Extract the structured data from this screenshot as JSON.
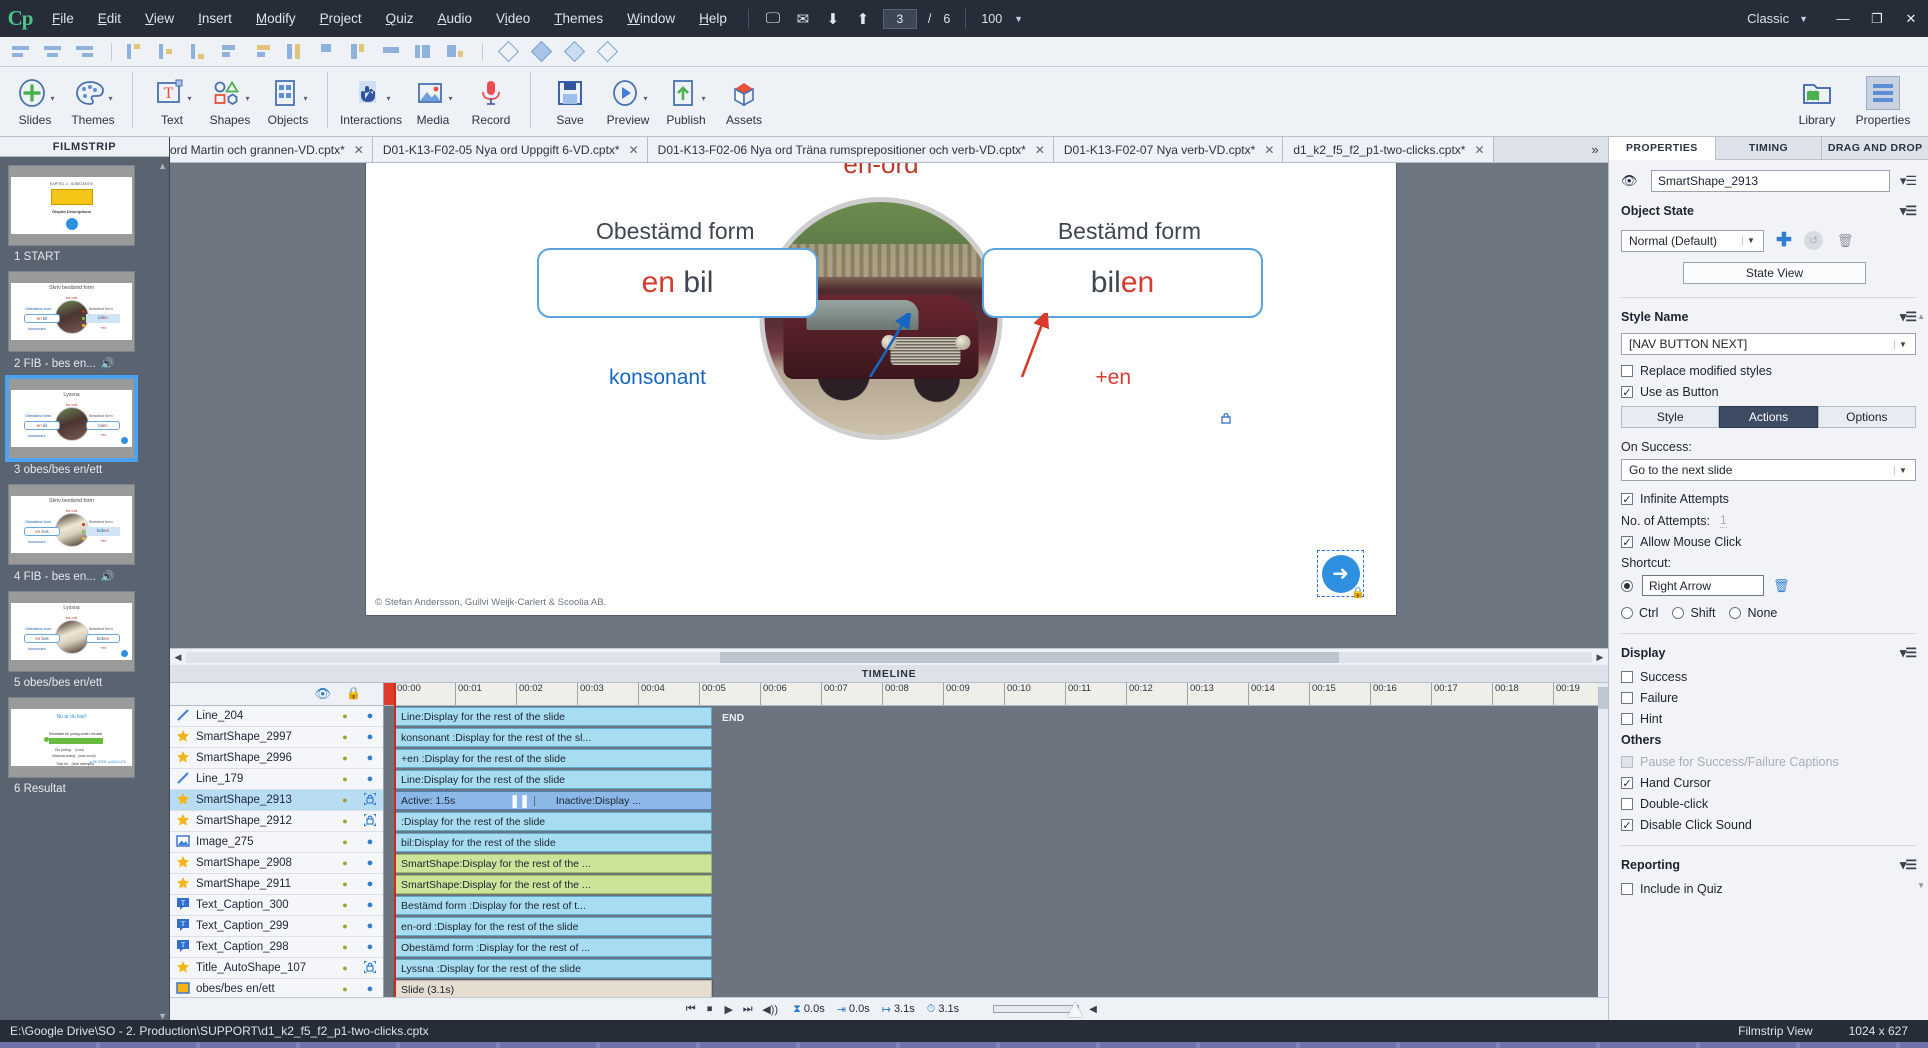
{
  "app": {
    "logo": "Cp",
    "layout_preset": "Classic"
  },
  "menu": {
    "items": [
      "File",
      "Edit",
      "View",
      "Insert",
      "Modify",
      "Project",
      "Quiz",
      "Audio",
      "Video",
      "Themes",
      "Window",
      "Help"
    ],
    "slide_current": "3",
    "slide_sep": "/",
    "slide_total": "6",
    "zoom_value": "100"
  },
  "window_controls": {
    "minimize": "—",
    "maximize": "❐",
    "close": "✕"
  },
  "ribbon": {
    "groups": [
      {
        "buttons": [
          {
            "label": "Slides",
            "icon": "add-slide-icon",
            "caret": true
          },
          {
            "label": "Themes",
            "icon": "palette-icon",
            "caret": true
          }
        ]
      },
      {
        "buttons": [
          {
            "label": "Text",
            "icon": "text-box-icon",
            "caret": true
          },
          {
            "label": "Shapes",
            "icon": "shapes-icon",
            "caret": true
          },
          {
            "label": "Objects",
            "icon": "objects-grid-icon",
            "caret": true
          }
        ]
      },
      {
        "buttons": [
          {
            "label": "Interactions",
            "icon": "hand-click-icon",
            "caret": true
          },
          {
            "label": "Media",
            "icon": "media-image-icon",
            "caret": true
          },
          {
            "label": "Record",
            "icon": "microphone-icon",
            "caret": false
          }
        ]
      },
      {
        "buttons": [
          {
            "label": "Save",
            "icon": "floppy-save-icon",
            "caret": false
          },
          {
            "label": "Preview",
            "icon": "play-preview-icon",
            "caret": true
          },
          {
            "label": "Publish",
            "icon": "publish-upload-icon",
            "caret": true
          },
          {
            "label": "Assets",
            "icon": "assets-box-icon",
            "caret": false
          }
        ]
      }
    ],
    "right_buttons": [
      {
        "label": "Library",
        "icon": "library-folder-icon"
      },
      {
        "label": "Properties",
        "icon": "properties-lines-icon"
      }
    ]
  },
  "tabs": {
    "items": [
      {
        "label": "ord Martin och grannen-VD.cptx*",
        "clipped": true
      },
      {
        "label": "D01-K13-F02-05 Nya ord Uppgift 6-VD.cptx*",
        "clipped": false
      },
      {
        "label": "D01-K13-F02-06 Nya ord Träna rumsprepositioner och verb-VD.cptx*",
        "clipped": false
      },
      {
        "label": "D01-K13-F02-07 Nya verb-VD.cptx*",
        "clipped": false
      },
      {
        "label": "d1_k2_f5_f2_p1-two-clicks.cptx*",
        "clipped": false
      }
    ],
    "close_glyph": "✕",
    "overflow_glyph": "»"
  },
  "filmstrip": {
    "title": "FILMSTRIP",
    "slides": [
      {
        "label": "1 START",
        "audio": false,
        "selected": false,
        "kind": "start"
      },
      {
        "label": "2 FIB - bes en...",
        "audio": true,
        "selected": false,
        "kind": "fib-car"
      },
      {
        "label": "3 obes/bes en/ett",
        "audio": false,
        "selected": true,
        "kind": "lyssna-car"
      },
      {
        "label": "4 FIB - bes en...",
        "audio": true,
        "selected": false,
        "kind": "fib-book"
      },
      {
        "label": "5 obes/bes en/ett",
        "audio": false,
        "selected": false,
        "kind": "lyssna-book"
      },
      {
        "label": "6 Resultat",
        "audio": false,
        "selected": false,
        "kind": "resultat"
      }
    ],
    "mini": {
      "title_fib": "Skriv bestämd form",
      "title_lyssna": "Lyssna",
      "title_start": "KAPITEL 2 - SUBSTANTIV",
      "title_resultat": "Nu är du klar!",
      "word": "en-ord",
      "obestamd": "Obestämd form",
      "bestamd": "Bestämd form",
      "en_bil": "en bil",
      "bilen": "bilen",
      "en_bok": "en bok",
      "boken": "boken",
      "konsonant": "konsonant",
      "plus_en": "+en"
    }
  },
  "stage": {
    "title": "en-ord",
    "heading_left": "Obestämd form",
    "heading_right": "Bestämd form",
    "box_left_prefix": "en",
    "box_left_word": "bil",
    "box_right_stem": "bil",
    "box_right_suffix": "en",
    "label_konsonant": "konsonant",
    "label_plus_en": "+en",
    "copyright": "© Stefan Andersson, Gullvi Weijk-Carlert & Scoolia AB.",
    "nav_arrow": "➜"
  },
  "timeline": {
    "title": "TIMELINE",
    "eye_icon": "eye-icon",
    "lock_icon": "lock-icon",
    "end_marker": "END",
    "ruler": [
      "00:00",
      "00:01",
      "00:02",
      "00:03",
      "00:04",
      "00:05",
      "00:06",
      "00:07",
      "00:08",
      "00:09",
      "00:10",
      "00:11",
      "00:12",
      "00:13",
      "00:14",
      "00:15",
      "00:16",
      "00:17",
      "00:18",
      "00:19"
    ],
    "rows": [
      {
        "icon": "line-icon",
        "name": "Line_204",
        "bar": "Line:Display for the rest of the slide",
        "color": "blue",
        "locked": false,
        "selected": false
      },
      {
        "icon": "star-icon",
        "name": "SmartShape_2997",
        "bar": "konsonant :Display for the rest of the sl...",
        "color": "blue",
        "locked": false,
        "selected": false
      },
      {
        "icon": "star-icon",
        "name": "SmartShape_2996",
        "bar": "+en :Display for the rest of the slide",
        "color": "blue",
        "locked": false,
        "selected": false
      },
      {
        "icon": "line-icon",
        "name": "Line_179",
        "bar": "Line:Display for the rest of the slide",
        "color": "blue",
        "locked": false,
        "selected": false
      },
      {
        "icon": "star-icon",
        "name": "SmartShape_2913",
        "bar": "Active: 1.5s",
        "bar2": "Inactive:Display ...",
        "color": "active",
        "locked": true,
        "selected": true
      },
      {
        "icon": "star-icon",
        "name": "SmartShape_2912",
        "bar": ":Display for the rest of the slide",
        "color": "blue",
        "locked": true,
        "selected": false
      },
      {
        "icon": "image-icon",
        "name": "Image_275",
        "bar": "bil:Display for the rest of the slide",
        "color": "blue",
        "locked": false,
        "selected": false
      },
      {
        "icon": "star-icon",
        "name": "SmartShape_2908",
        "bar": "SmartShape:Display for the rest of the ...",
        "color": "green",
        "locked": false,
        "selected": false
      },
      {
        "icon": "star-icon",
        "name": "SmartShape_2911",
        "bar": "SmartShape:Display for the rest of the ...",
        "color": "green",
        "locked": false,
        "selected": false
      },
      {
        "icon": "caption-icon",
        "name": "Text_Caption_300",
        "bar": "Bestämd form :Display for the rest of t...",
        "color": "blue",
        "locked": false,
        "selected": false
      },
      {
        "icon": "caption-icon",
        "name": "Text_Caption_299",
        "bar": "en-ord :Display for the rest of the slide",
        "color": "blue",
        "locked": false,
        "selected": false
      },
      {
        "icon": "caption-icon",
        "name": "Text_Caption_298",
        "bar": "Obestämd form :Display for the rest of ...",
        "color": "blue",
        "locked": false,
        "selected": false
      },
      {
        "icon": "star-icon",
        "name": "Title_AutoShape_107",
        "bar": "Lyssna :Display for the rest of the slide",
        "color": "blue",
        "locked": true,
        "selected": false
      },
      {
        "icon": "slide-icon",
        "name": "obes/bes en/ett",
        "bar": "Slide (3.1s)",
        "color": "slide",
        "locked": false,
        "selected": false
      }
    ],
    "controls": {
      "first": "⏮",
      "stop": "⏹",
      "play": "▶",
      "last": "⏭",
      "audio": "◀))",
      "start_time": "0.0s",
      "offset_time": "0.0s",
      "duration": "3.1s",
      "total": "3.1s"
    }
  },
  "properties": {
    "tabs": [
      {
        "label": "PROPERTIES",
        "active": true
      },
      {
        "label": "TIMING",
        "active": false
      },
      {
        "label": "DRAG AND DROP",
        "active": false
      }
    ],
    "object_name": "SmartShape_2913",
    "object_state_heading": "Object State",
    "object_state_value": "Normal (Default)",
    "state_view_button": "State View",
    "style_name_heading": "Style Name",
    "style_name_value": "[NAV BUTTON NEXT]",
    "replace_modified_styles": {
      "label": "Replace modified styles",
      "checked": false
    },
    "use_as_button": {
      "label": "Use as Button",
      "checked": true
    },
    "subtabs": [
      {
        "label": "Style",
        "active": false
      },
      {
        "label": "Actions",
        "active": true
      },
      {
        "label": "Options",
        "active": false
      }
    ],
    "on_success_label": "On Success:",
    "on_success_value": "Go to the next slide",
    "infinite_attempts": {
      "label": "Infinite Attempts",
      "checked": true
    },
    "no_of_attempts_label": "No. of Attempts:",
    "no_of_attempts_value": "1",
    "allow_mouse_click": {
      "label": "Allow Mouse Click",
      "checked": true
    },
    "shortcut_label": "Shortcut:",
    "shortcut_value": "Right Arrow",
    "modifiers": [
      {
        "label": "Ctrl",
        "selected": false
      },
      {
        "label": "Shift",
        "selected": false
      },
      {
        "label": "None",
        "selected": false
      }
    ],
    "display_heading": "Display",
    "display_items": [
      {
        "label": "Success",
        "checked": false,
        "disabled": false
      },
      {
        "label": "Failure",
        "checked": false,
        "disabled": false
      },
      {
        "label": "Hint",
        "checked": false,
        "disabled": false
      }
    ],
    "others_heading": "Others",
    "others_items": [
      {
        "label": "Pause for Success/Failure Captions",
        "checked": false,
        "disabled": true
      },
      {
        "label": "Hand Cursor",
        "checked": true,
        "disabled": false
      },
      {
        "label": "Double-click",
        "checked": false,
        "disabled": false
      },
      {
        "label": "Disable Click Sound",
        "checked": true,
        "disabled": false
      }
    ],
    "reporting_heading": "Reporting",
    "reporting_items": [
      {
        "label": "Include in Quiz",
        "checked": false,
        "disabled": false
      }
    ]
  },
  "statusbar": {
    "path": "E:\\Google Drive\\SO - 2. Production\\SUPPORT\\d1_k2_f5_f2_p1-two-clicks.cptx",
    "view_mode": "Filmstrip View",
    "dimensions": "1024 x 627"
  }
}
